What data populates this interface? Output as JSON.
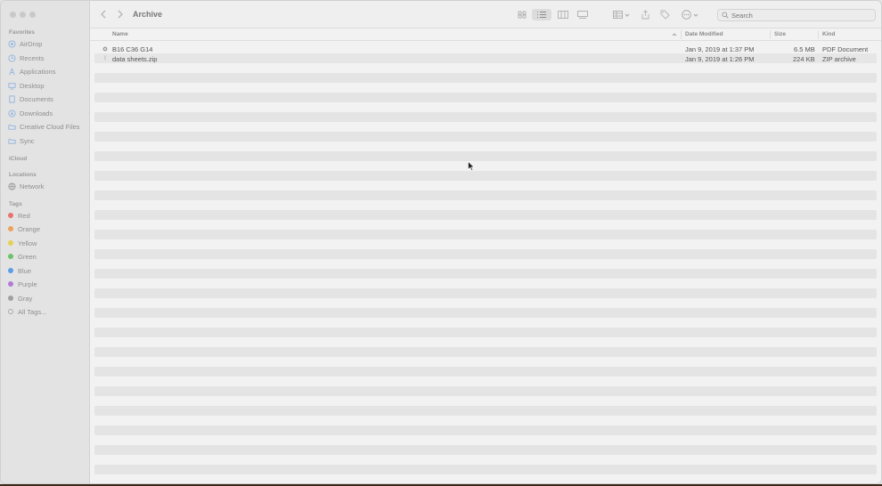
{
  "window": {
    "title": "Archive"
  },
  "sidebar": {
    "favorites_header": "Favorites",
    "favorites": [
      {
        "label": "AirDrop",
        "icon": "airdrop-icon"
      },
      {
        "label": "Recents",
        "icon": "clock-icon"
      },
      {
        "label": "Applications",
        "icon": "applications-icon"
      },
      {
        "label": "Desktop",
        "icon": "desktop-icon"
      },
      {
        "label": "Documents",
        "icon": "document-icon"
      },
      {
        "label": "Downloads",
        "icon": "download-icon"
      },
      {
        "label": "Creative Cloud Files",
        "icon": "folder-icon"
      },
      {
        "label": "Sync",
        "icon": "folder-icon"
      }
    ],
    "icloud_header": "iCloud",
    "locations_header": "Locations",
    "locations": [
      {
        "label": "Network",
        "icon": "globe-icon"
      }
    ],
    "tags_header": "Tags",
    "tags": [
      {
        "label": "Red",
        "color": "#e8746e"
      },
      {
        "label": "Orange",
        "color": "#eda25a"
      },
      {
        "label": "Yellow",
        "color": "#e6cf53"
      },
      {
        "label": "Green",
        "color": "#6cc36b"
      },
      {
        "label": "Blue",
        "color": "#5c9de8"
      },
      {
        "label": "Purple",
        "color": "#b27bd6"
      },
      {
        "label": "Gray",
        "color": "#a0a0a0"
      },
      {
        "label": "All Tags...",
        "color": ""
      }
    ]
  },
  "toolbar": {
    "search_placeholder": "Search"
  },
  "columns": {
    "name": "Name",
    "date": "Date Modified",
    "size": "Size",
    "kind": "Kind"
  },
  "files": [
    {
      "name": "B16 C36 G14",
      "date": "Jan 9, 2019 at 1:37 PM",
      "size": "6.5 MB",
      "kind": "PDF Document"
    },
    {
      "name": "data sheets.zip",
      "date": "Jan 9, 2019 at 1:26 PM",
      "size": "224 KB",
      "kind": "ZIP archive"
    }
  ]
}
